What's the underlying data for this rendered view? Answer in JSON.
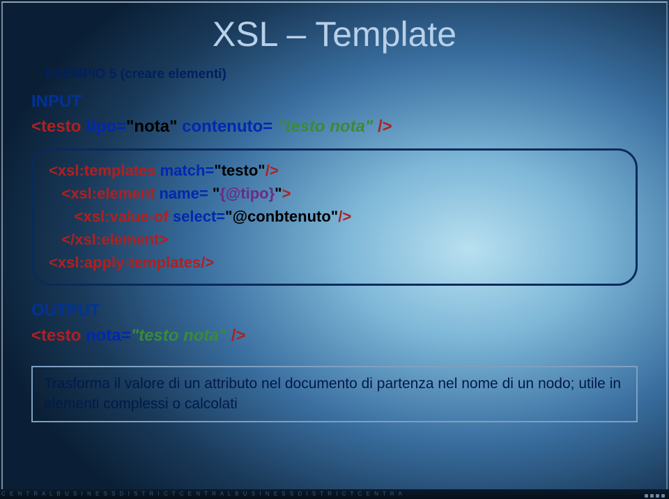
{
  "title": "XSL – Template",
  "subtitle": "ESEMPIO 5 (creare elementi)",
  "input": {
    "label": "INPUT",
    "prefix": "<",
    "tag": "testo",
    "attr1": " tipo",
    "eq1": "=",
    "val1_open": "\"",
    "val1": "nota",
    "val1_close": "\"",
    "attr2": " contenuto",
    "eq2": "= ",
    "val2_open": "\"",
    "val2": "testo nota",
    "val2_close": "\" ",
    "suffix": "/>"
  },
  "code": {
    "l1_p": "<",
    "l1_t": "xsl:templates",
    "l1_a": " match",
    "l1_e": "=",
    "l1_v": "\"testo\"",
    "l1_s": "/>",
    "l2_p": "   <",
    "l2_t": "xsl:element",
    "l2_a": " name",
    "l2_e": "= ",
    "l2_q1": "\"",
    "l2_v": "{@tipo}",
    "l2_q2": "\"",
    "l2_s": ">",
    "l3_p": "      <",
    "l3_t": "xsl:value-of",
    "l3_a": " select",
    "l3_e": "=",
    "l3_v": "\"@conbtenuto\"",
    "l3_s": "/>",
    "l4_p": "   </",
    "l4_t": "xsl:element",
    "l4_s": ">",
    "l5_p": "<",
    "l5_t": "xsl:apply-templates",
    "l5_s": "/>"
  },
  "output": {
    "label": "OUTPUT",
    "prefix": "<",
    "tag": "testo",
    "attr1": " nota",
    "eq1": "=",
    "val1_open": "\"",
    "val1": "testo nota",
    "val1_close": "\" ",
    "suffix": "/>"
  },
  "caption": "Trasforma il valore di un attributo nel documento di partenza nel nome di un nodo; utile in elementi complessi o calcolati",
  "footer": "C E N T R A L B U S I N E S S D I S T R I C T C E N T R A L B U S I N E S S D I S T R I C T C E N T R A"
}
